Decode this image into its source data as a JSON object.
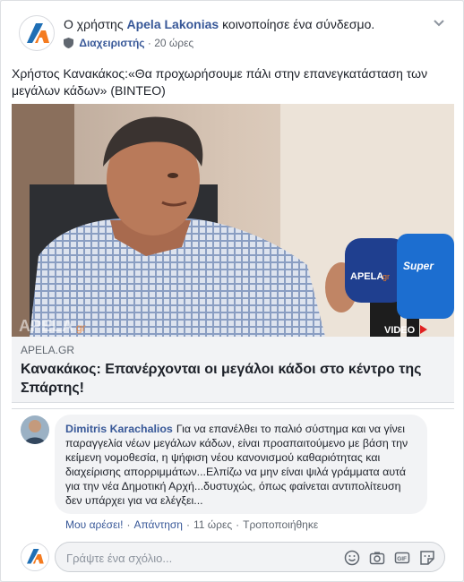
{
  "header": {
    "prefix": "Ο χρήστης",
    "author": "Apela Lakonias",
    "suffix": "κοινοποίησε ένα σύνδεσμο.",
    "role": "Διαχειριστής",
    "separator": "·",
    "time": "20 ώρες",
    "logo_letter": "A"
  },
  "post": {
    "caption": "Χρήστος Κανακάκος:«Θα προχωρήσουμε πάλι στην επανεγκατάσταση των μεγάλων κάδων» (ΒΙΝΤΕΟ)"
  },
  "link": {
    "domain": "APELA.GR",
    "title": "Κανακάκος: Επανέρχονται οι μεγάλοι κάδοι στο κέντρο της Σπάρτης!",
    "watermark": "APELA",
    "watermark_gr": "gr",
    "badge": "VIDEO",
    "mic_left": "APELA",
    "mic_left_gr": "gr",
    "mic_right": "Super"
  },
  "comment": {
    "author": "Dimitris Karachalios",
    "text": "Για να επανέλθει το παλιό σύστημα και να γίνει παραγγελία νέων μεγάλων κάδων, είναι προαπαιτούμενο με βάση την κείμενη νομοθεσία, η ψήφιση νέου κανονισμού καθαριότητας και διαχείρισης απορριμμάτων...Ελπίζω να μην είναι ψιλά γράμματα αυτά για την νέα Δημοτική Αρχή...δυστυχώς, όπως φαίνεται αντιπολίτευση δεν υπάρχει για να ελέγξει...",
    "like": "Μου αρέσει!",
    "reply": "Απάντηση",
    "time": "11 ώρες",
    "edited": "Τροποποιήθηκε",
    "dot": "·"
  },
  "reply_box": {
    "placeholder": "Γράψτε ένα σχόλιο..."
  },
  "colors": {
    "brand_blue": "#385898",
    "logo_orange": "#f47b20",
    "logo_blue": "#1f6fb5"
  }
}
